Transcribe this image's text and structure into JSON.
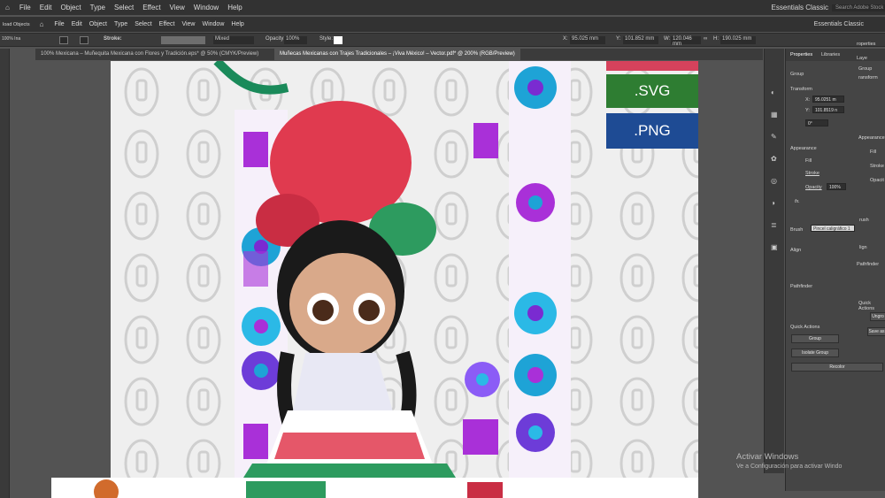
{
  "menubar": {
    "items": [
      "File",
      "Edit",
      "Object",
      "Type",
      "Select",
      "Effect",
      "View",
      "Window",
      "Help"
    ],
    "workspace": "Essentials Classic",
    "search_placeholder": "Search Adobe Stock"
  },
  "menubar2": {
    "items": [
      "File",
      "Edit",
      "Object",
      "Type",
      "Select",
      "Effect",
      "View",
      "Window",
      "Help"
    ],
    "workspace": "Essentials Classic",
    "left_label": "load Objects",
    "left_label2": "100% Ina"
  },
  "control": {
    "stroke_label": "Stroke:",
    "brush_value": "Mixed",
    "opacity_label": "Opacity:",
    "opacity_value": "100%",
    "style_label": "Style:",
    "x_label": "X:",
    "x_value": "95.025 mm",
    "y_label": "Y:",
    "y_value": "101.852 mm",
    "w_label": "W:",
    "w_value": "120.046 mm",
    "h_label": "H:",
    "h_value": "190.025 mm"
  },
  "tabs": [
    {
      "label": "100% Mexicana – Muñequita Mexicana con Flores y Tradición.eps* @ 50% (CMYK/Preview)"
    },
    {
      "label": "Muñecas Mexicanas con Trajes Tradicionales – ¡Viva México! – Vector.pdf* @ 200% (RGB/Preview)"
    }
  ],
  "panel": {
    "tab_properties": "Properties",
    "tab_libraries": "Libraries",
    "group_label": "Group",
    "transform_label": "Transform",
    "x_label": "X:",
    "x_value": "95.0251 m",
    "y_label": "Y:",
    "y_value": "101.8519 n",
    "angle_value": "0°",
    "appearance_label": "Appearance",
    "fill_label": "Fill",
    "stroke_label": "Stroke",
    "opacity_label": "Opacity",
    "opacity_value": "100%",
    "fx_label": "fx.",
    "brush_label": "Brush",
    "brush_value": "Pincel caligráfico 1",
    "align_label": "Align",
    "pathfinder_label": "Pathfinder",
    "quick_actions_label": "Quick Actions",
    "btn_group": "Group",
    "btn_isolate": "Isolate Group",
    "btn_recolor": "Recolor"
  },
  "panel2": {
    "properties": "roperties",
    "layer": "Laye",
    "group": "Group",
    "transform": "ransform",
    "appearance": "Appearance",
    "fill": "Fill",
    "stroke": "Stroke",
    "opacity": "Opacit",
    "brush": "rush",
    "align": "lign",
    "pathfinder": "Pathfinder",
    "quick": "Quick Actions",
    "ungroup": "Ungro",
    "save": "Save as"
  },
  "canvas": {
    "badge_svg": ".SVG",
    "badge_png": ".PNG",
    "watermark": "ivector",
    "badge_svg_color": "#2e7d32",
    "badge_png_color": "#1e4b94",
    "badge_top_color": "#d6425c"
  },
  "windows_activation": {
    "title": "Activar Windows",
    "subtitle": "Ve a Configuración para activar Windo"
  }
}
